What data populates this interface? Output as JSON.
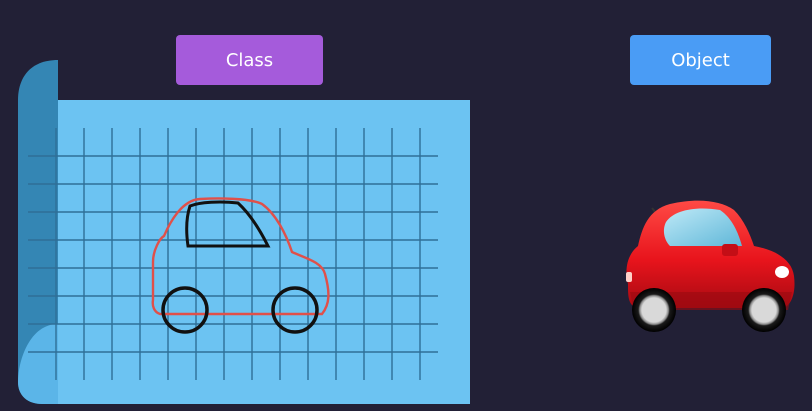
{
  "class_label": "Class",
  "object_label": "Object",
  "colors": {
    "background": "#222036",
    "class_accent": "#a55bdb",
    "object_accent": "#4a9cf5",
    "blueprint_paper": "#6cc3f2",
    "blueprint_roll": "#3486b4",
    "grid_line": "#2f6f97",
    "sketch_outline": "#e0504a",
    "sketch_detail": "#111111",
    "car_body": "#e8141c"
  },
  "icons": {
    "blueprint": "blueprint-paper-icon",
    "sketch": "car-sketch-icon",
    "object": "red-car-icon"
  }
}
